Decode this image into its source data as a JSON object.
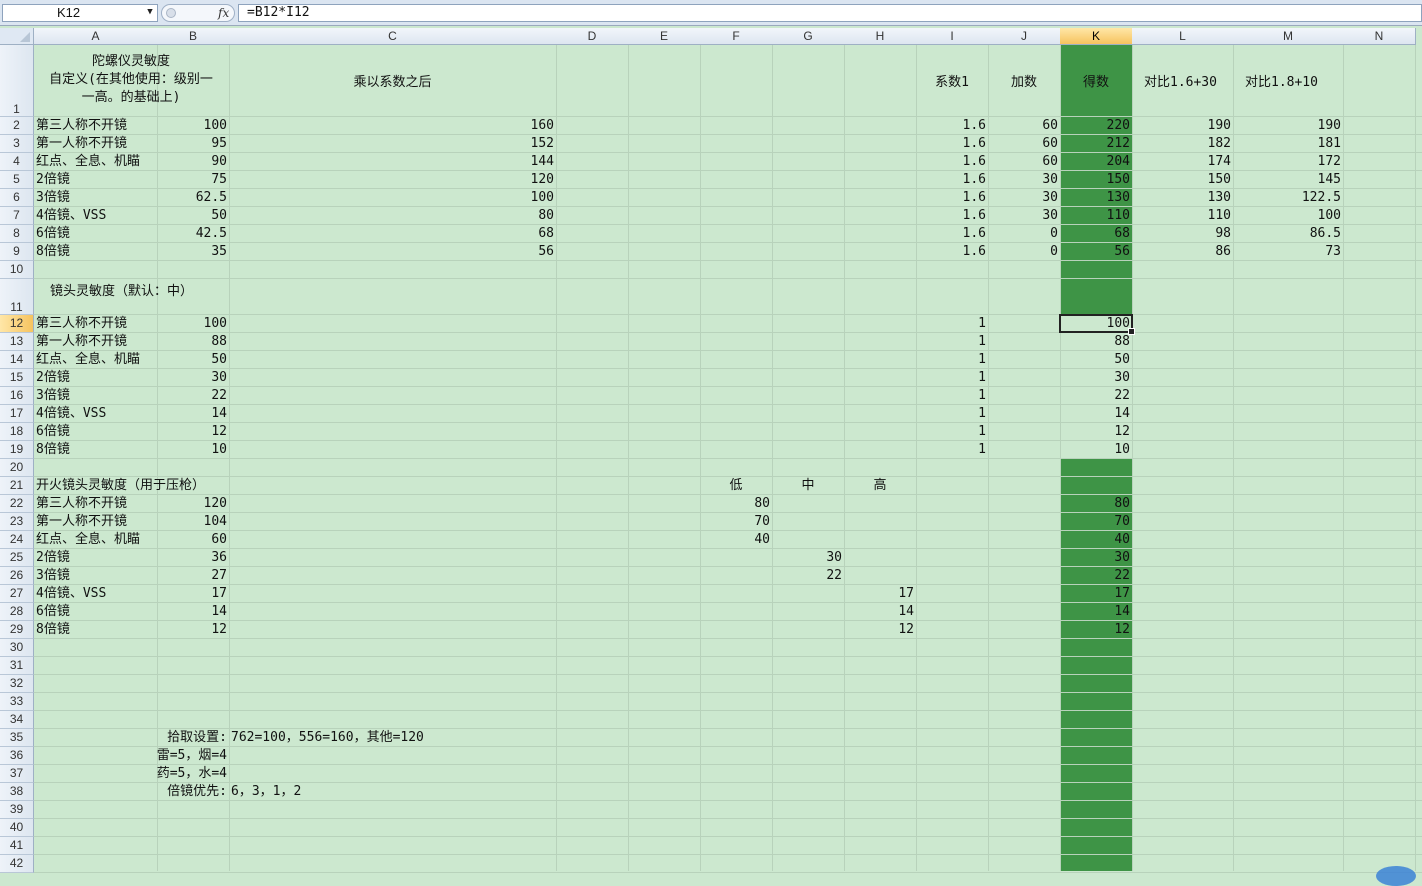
{
  "formula_bar": {
    "name_box": "K12",
    "fx_label": "fx",
    "formula": "=B12*I12"
  },
  "columns": [
    "A",
    "B",
    "C",
    "D",
    "E",
    "F",
    "G",
    "H",
    "I",
    "J",
    "K",
    "L",
    "M",
    "N"
  ],
  "active_column": "K",
  "active_row": "12",
  "header_row": {
    "a_lines": [
      "陀螺仪灵敏度",
      "自定义(在其他使用：级别一",
      "一高。的基础上)"
    ],
    "c": "乘以系数之后",
    "i": "系数1",
    "j": "加数",
    "k": "得数",
    "l": "对比1.6+30",
    "m": "对比1.8+10"
  },
  "gyro_rows": [
    {
      "row": "2",
      "a": "第三人称不开镜",
      "b": "100",
      "c": "160",
      "i": "1.6",
      "j": "60",
      "k": "220",
      "l": "190",
      "m": "190"
    },
    {
      "row": "3",
      "a": "第一人称不开镜",
      "b": "95",
      "c": "152",
      "i": "1.6",
      "j": "60",
      "k": "212",
      "l": "182",
      "m": "181"
    },
    {
      "row": "4",
      "a": "红点、全息、机瞄",
      "b": "90",
      "c": "144",
      "i": "1.6",
      "j": "60",
      "k": "204",
      "l": "174",
      "m": "172"
    },
    {
      "row": "5",
      "a": "2倍镜",
      "b": "75",
      "c": "120",
      "i": "1.6",
      "j": "30",
      "k": "150",
      "l": "150",
      "m": "145"
    },
    {
      "row": "6",
      "a": "3倍镜",
      "b": "62.5",
      "c": "100",
      "i": "1.6",
      "j": "30",
      "k": "130",
      "l": "130",
      "m": "122.5"
    },
    {
      "row": "7",
      "a": "4倍镜、VSS",
      "b": "50",
      "c": "80",
      "i": "1.6",
      "j": "30",
      "k": "110",
      "l": "110",
      "m": "100"
    },
    {
      "row": "8",
      "a": "6倍镜",
      "b": "42.5",
      "c": "68",
      "i": "1.6",
      "j": "0",
      "k": "68",
      "l": "98",
      "m": "86.5"
    },
    {
      "row": "9",
      "a": "8倍镜",
      "b": "35",
      "c": "56",
      "i": "1.6",
      "j": "0",
      "k": "56",
      "l": "86",
      "m": "73"
    }
  ],
  "lens_title": "镜头灵敏度（默认：中）",
  "lens_rows": [
    {
      "row": "12",
      "a": "第三人称不开镜",
      "b": "100",
      "i": "1",
      "k": "100"
    },
    {
      "row": "13",
      "a": "第一人称不开镜",
      "b": "88",
      "i": "1",
      "k": "88"
    },
    {
      "row": "14",
      "a": "红点、全息、机瞄",
      "b": "50",
      "i": "1",
      "k": "50"
    },
    {
      "row": "15",
      "a": "2倍镜",
      "b": "30",
      "i": "1",
      "k": "30"
    },
    {
      "row": "16",
      "a": "3倍镜",
      "b": "22",
      "i": "1",
      "k": "22"
    },
    {
      "row": "17",
      "a": "4倍镜、VSS",
      "b": "14",
      "i": "1",
      "k": "14"
    },
    {
      "row": "18",
      "a": "6倍镜",
      "b": "12",
      "i": "1",
      "k": "12"
    },
    {
      "row": "19",
      "a": "8倍镜",
      "b": "10",
      "i": "1",
      "k": "10"
    }
  ],
  "fire_title": "开火镜头灵敏度（用于压枪）",
  "fire_headers": {
    "f": "低",
    "g": "中",
    "h": "高"
  },
  "fire_rows": [
    {
      "row": "22",
      "a": "第三人称不开镜",
      "b": "120",
      "f": "80",
      "g": "",
      "h": "",
      "k": "80"
    },
    {
      "row": "23",
      "a": "第一人称不开镜",
      "b": "104",
      "f": "70",
      "g": "",
      "h": "",
      "k": "70"
    },
    {
      "row": "24",
      "a": "红点、全息、机瞄",
      "b": "60",
      "f": "40",
      "g": "",
      "h": "",
      "k": "40"
    },
    {
      "row": "25",
      "a": "2倍镜",
      "b": "36",
      "f": "",
      "g": "30",
      "h": "",
      "k": "30"
    },
    {
      "row": "26",
      "a": "3倍镜",
      "b": "27",
      "f": "",
      "g": "22",
      "h": "",
      "k": "22"
    },
    {
      "row": "27",
      "a": "4倍镜、VSS",
      "b": "17",
      "f": "",
      "g": "",
      "h": "17",
      "k": "17"
    },
    {
      "row": "28",
      "a": "6倍镜",
      "b": "14",
      "f": "",
      "g": "",
      "h": "14",
      "k": "14"
    },
    {
      "row": "29",
      "a": "8倍镜",
      "b": "12",
      "f": "",
      "g": "",
      "h": "12",
      "k": "12"
    }
  ],
  "notes": [
    {
      "row": "35",
      "b": "拾取设置:",
      "c": "762=100，556=160，其他=120"
    },
    {
      "row": "36",
      "b": "雷=5，烟=4",
      "c": ""
    },
    {
      "row": "37",
      "b": "药=5，水=4",
      "c": ""
    },
    {
      "row": "38",
      "b": "倍镜优先:",
      "c": "6，3，1，2"
    }
  ],
  "row_numbers": [
    "1",
    "2",
    "3",
    "4",
    "5",
    "6",
    "7",
    "8",
    "9",
    "10",
    "11",
    "12",
    "13",
    "14",
    "15",
    "16",
    "17",
    "18",
    "19",
    "20",
    "21",
    "22",
    "23",
    "24",
    "25",
    "26",
    "27",
    "28",
    "29",
    "30",
    "31",
    "32",
    "33",
    "34",
    "35",
    "36",
    "37",
    "38",
    "39",
    "40",
    "41",
    "42"
  ],
  "colors": {
    "sheet_bg": "#cce8cf",
    "highlight_col": "#3e9446",
    "active_header": "#f6c35f"
  }
}
